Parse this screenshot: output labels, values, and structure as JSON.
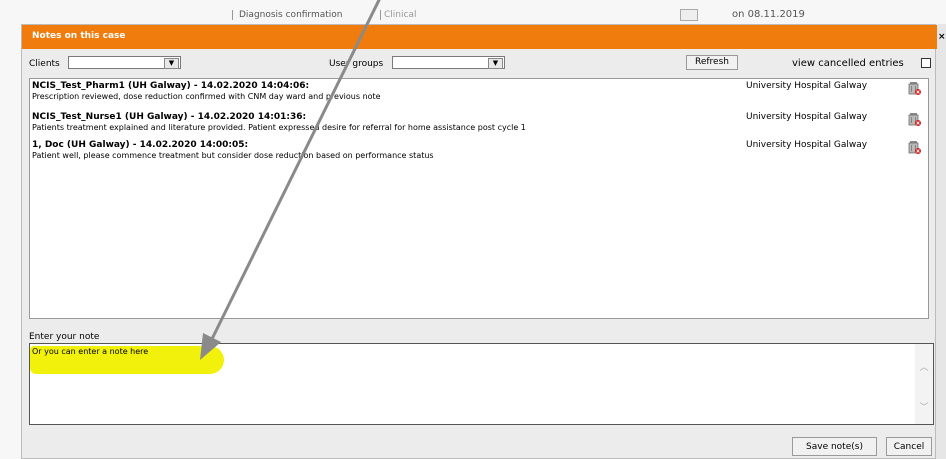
{
  "background": {
    "diagnosis_label": "Diagnosis confirmation",
    "diagnosis_value": "Clinical",
    "date_text": "on 08.11.2019",
    "close_glyph": "×"
  },
  "dialog": {
    "title": "Notes on this case",
    "title_bar_color": "#f07c0e",
    "filters": {
      "clients_label": "Clients",
      "clients_value": "",
      "user_groups_label": "User groups",
      "user_groups_value": "",
      "refresh_label": "Refresh",
      "view_cancelled_label": "view cancelled entries",
      "view_cancelled_checked": false
    },
    "notes": [
      {
        "header": "NCIS_Test_Pharm1 (UH Galway) - 14.02.2020 14:04:06:",
        "text": "Prescription reviewed, dose reduction confirmed with CNM day ward and previous note",
        "organisation": "University Hospital Galway",
        "delete_icon": "trash-icon"
      },
      {
        "header": "NCIS_Test_Nurse1 (UH Galway) - 14.02.2020 14:01:36:",
        "text": "Patients treatment explained and literature provided. Patient expressed desire for referral for home assistance post cycle 1",
        "organisation": "University Hospital Galway",
        "delete_icon": "trash-icon"
      },
      {
        "header": "1, Doc (UH Galway) - 14.02.2020 14:00:05:",
        "text": "Patient well, please commence treatment but consider dose reduction based on performance status",
        "organisation": "University Hospital Galway",
        "delete_icon": "trash-icon"
      }
    ],
    "enter_note_label": "Enter your note",
    "note_value": "Or you can enter a note here",
    "highlight_color": "#f2f10c",
    "save_label": "Save note(s)",
    "cancel_label": "Cancel"
  }
}
